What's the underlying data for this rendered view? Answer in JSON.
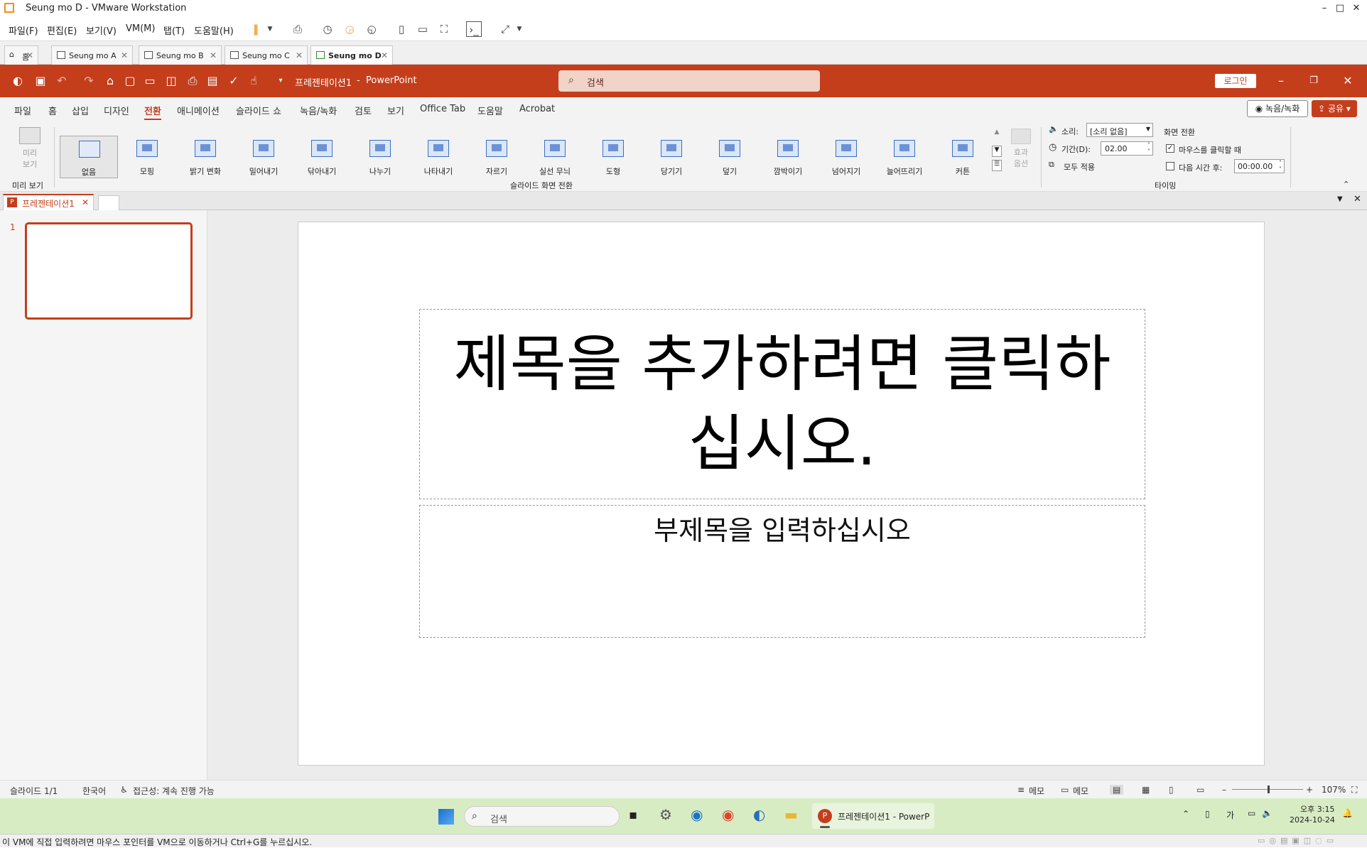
{
  "vm": {
    "title": "Seung mo D - VMware Workstation",
    "menu": [
      "파일(F)",
      "편집(E)",
      "보기(V)",
      "VM(M)",
      "탭(T)",
      "도움말(H)"
    ],
    "tabs": [
      {
        "label": "홈"
      },
      {
        "label": "Seung mo A"
      },
      {
        "label": "Seung mo B"
      },
      {
        "label": "Seung mo C"
      },
      {
        "label": "Seung mo D"
      }
    ],
    "status_hint": "이 VM에 직접 입력하려면 마우스 포인터를 VM으로 이동하거나 Ctrl+G를 누르십시오."
  },
  "pp": {
    "doc_title": "프레젠테이션1",
    "app_sep": "-",
    "app": "PowerPoint",
    "search_placeholder": "검색",
    "login": "로그인",
    "menu": [
      "파일",
      "홈",
      "삽입",
      "디자인",
      "전환",
      "애니메이션",
      "슬라이드 쇼",
      "녹음/녹화",
      "검토",
      "보기",
      "Office Tab",
      "도움말",
      "Acrobat"
    ],
    "record": "녹음/녹화",
    "share": "공유",
    "preview_label": "미리\n보기",
    "preview_group": "미리 보기",
    "transitions": [
      "없음",
      "모핑",
      "밝기 변화",
      "밀어내기",
      "닦아내기",
      "나누기",
      "나타내기",
      "자르기",
      "실선 무늬",
      "도형",
      "당기기",
      "덮기",
      "깜박이기",
      "넘어지기",
      "늘어뜨리기",
      "커튼"
    ],
    "transition_group": "슬라이드 화면 전환",
    "effect_options": "효과\n옵션",
    "sound_label": "소리:",
    "sound_value": "[소리 없음]",
    "duration_label": "기간(D):",
    "duration_value": "02.00",
    "apply_all": "모두 적용",
    "advance_title": "화면 전환",
    "on_click": "마우스를 클릭할 때",
    "after_label": "다음 시간 후:",
    "after_value": "00:00.00",
    "timing_group": "타이밍",
    "doc_tab": "프레젠테이션1",
    "slide_number": "1",
    "title_placeholder": "제목을 추가하려면 클릭하십시오.",
    "subtitle_placeholder": "부제목을 입력하십시오",
    "status": {
      "slide": "슬라이드 1/1",
      "lang": "한국어",
      "access": "접근성: 계속 진행 가능",
      "notes": "메모",
      "comments": "메모",
      "zoom": "107%"
    }
  },
  "taskbar": {
    "search": "검색",
    "app_label": "프레젠테이션1 - PowerP",
    "ime": "가",
    "time": "오후 3:15",
    "date": "2024-10-24"
  }
}
